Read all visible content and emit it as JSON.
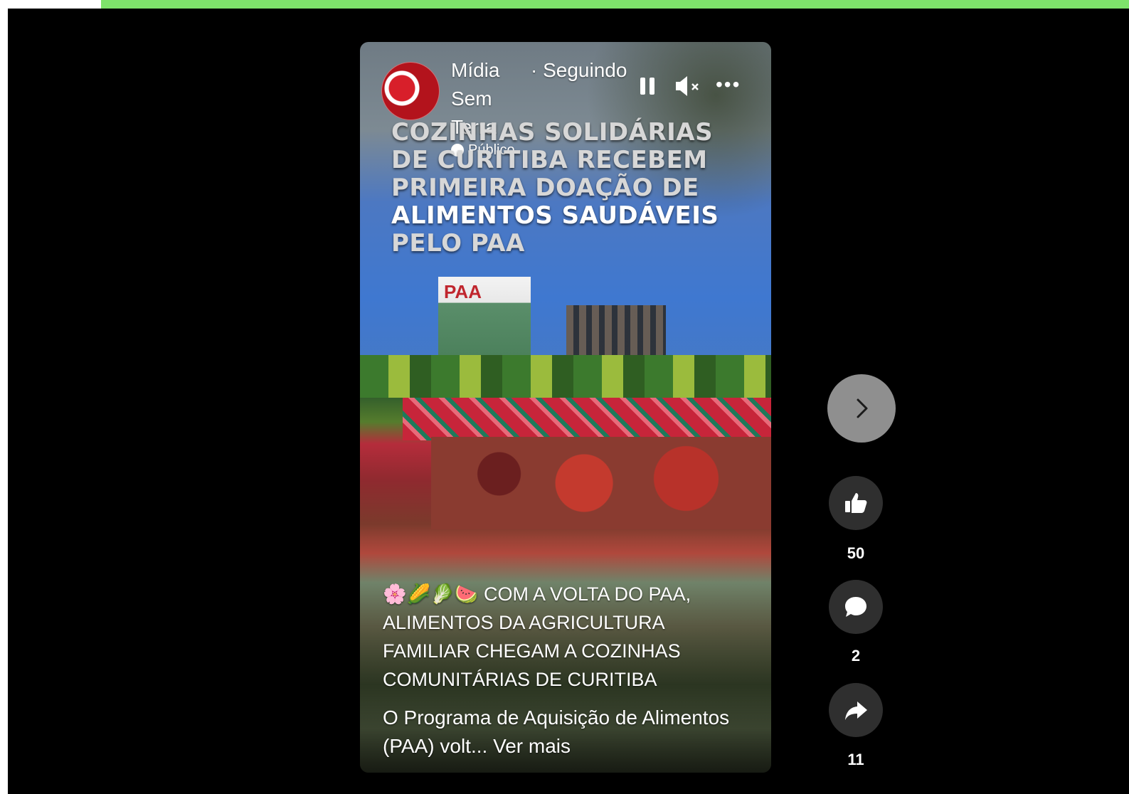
{
  "reel": {
    "author": "Mídia Sem Terra",
    "following_label": "· Seguindo",
    "privacy": "Público",
    "headline_lines": [
      "COZINHAS SOLIDÁRIAS",
      "DE CURITIBA RECEBEM",
      "PRIMEIRA DOAÇÃO DE",
      "ALIMENTOS SAUDÁVEIS",
      "PELO PAA"
    ],
    "banner_text": "PAA",
    "caption_emojis": "🌸🌽🥬🍉",
    "caption": "COM A VOLTA DO PAA, ALIMENTOS DA AGRICULTURA FAMILIAR CHEGAM A COZINHAS COMUNITÁRIAS DE CURITIBA",
    "description": "O Programa de Aquisição de Alimentos (PAA) volt...",
    "see_more": "Ver mais"
  },
  "controls": {
    "pause_icon": "pause-icon",
    "mute_icon": "muted-speaker-icon",
    "more_icon": "more-options-icon",
    "more_label": "•••"
  },
  "actions": {
    "likes": "50",
    "comments": "2",
    "shares": "11"
  },
  "colors": {
    "page_background": "#000000",
    "top_strip": "#7ee36b",
    "next_button": "#8f8f8f",
    "action_button": "#2f2f2f"
  }
}
